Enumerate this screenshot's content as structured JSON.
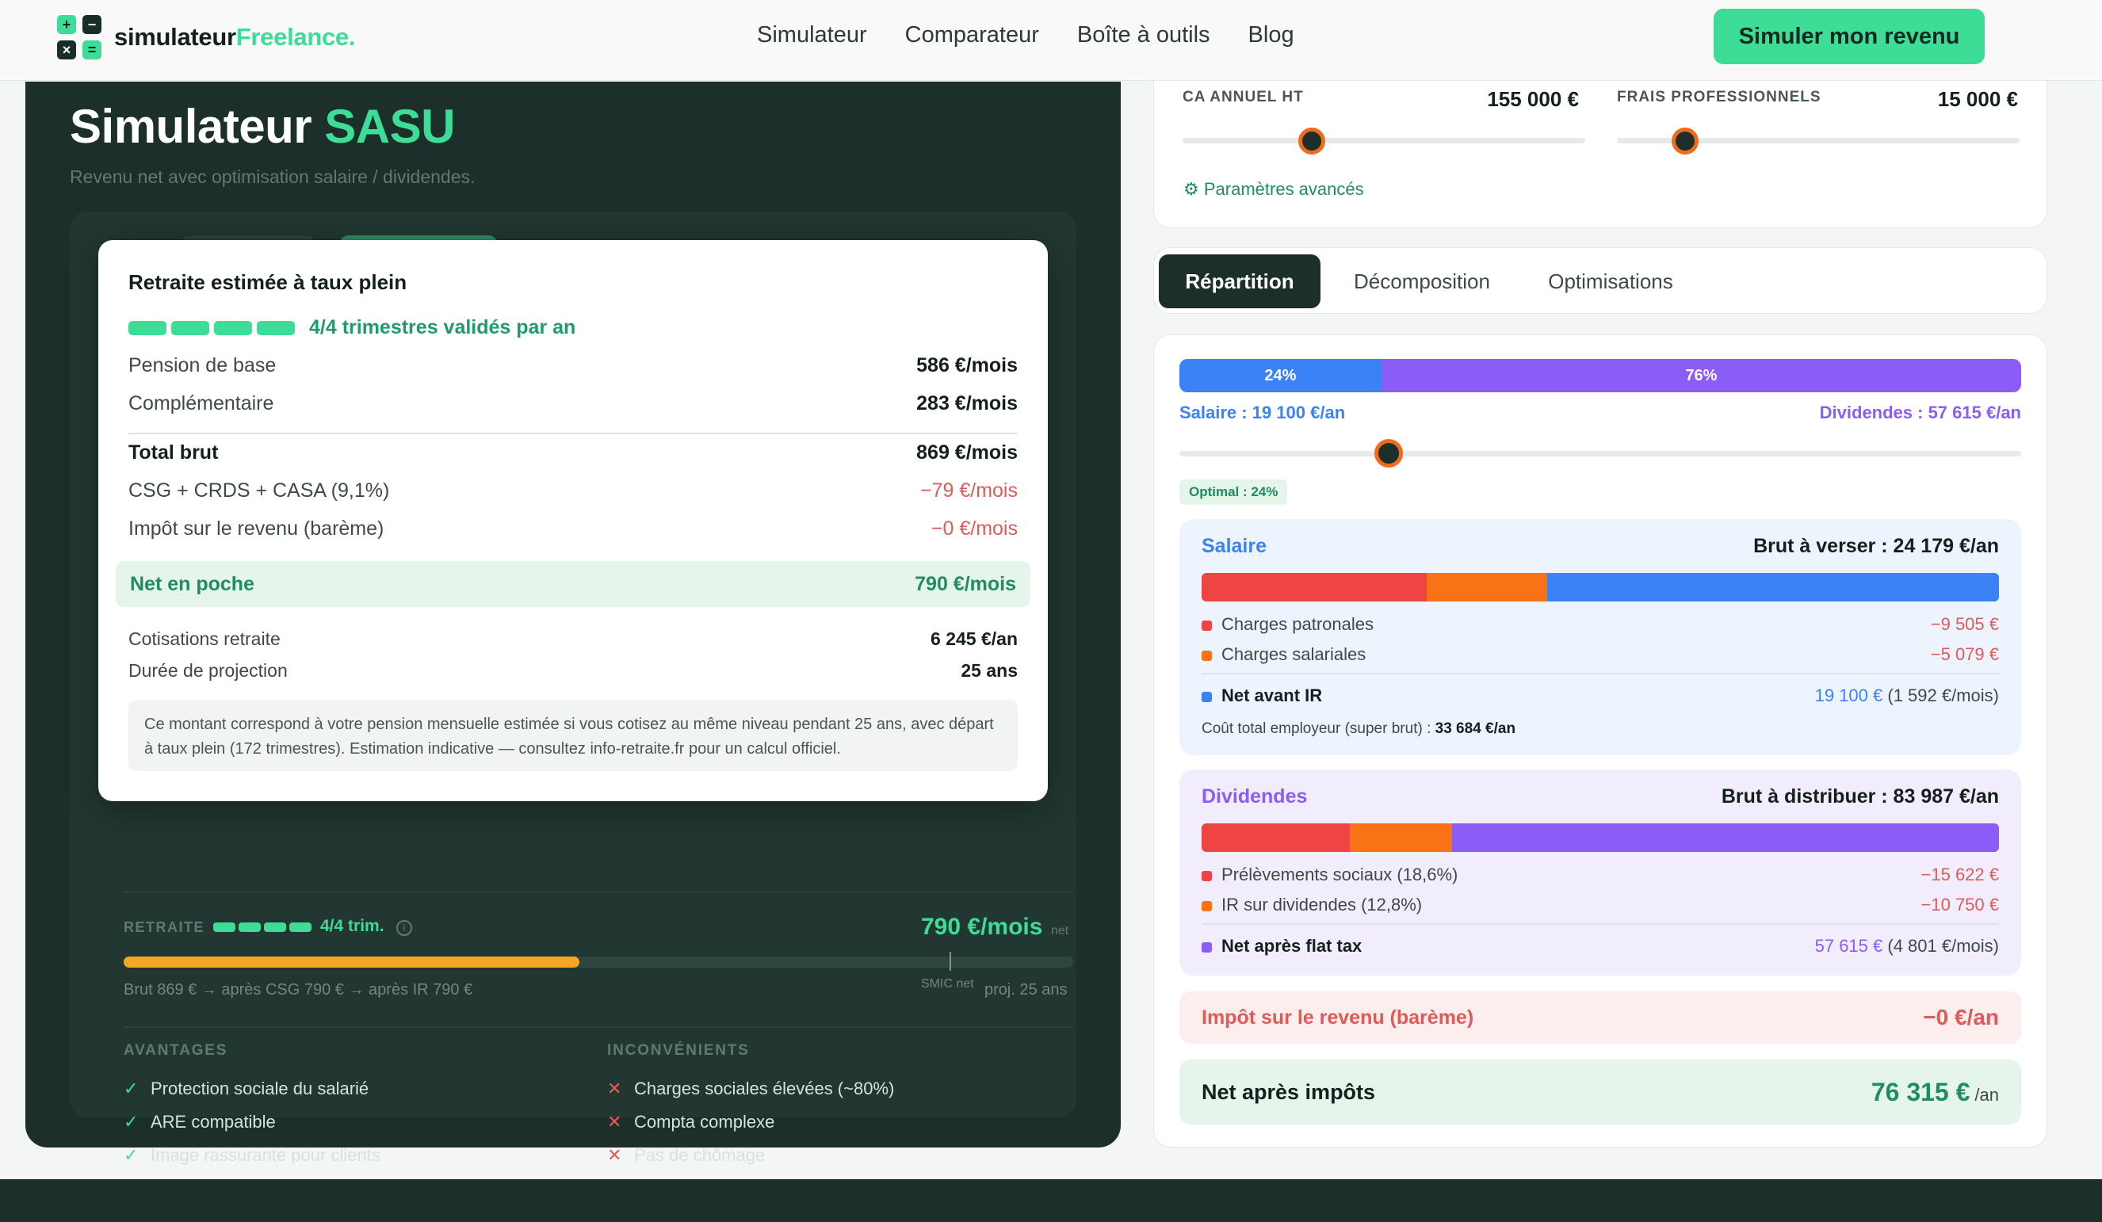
{
  "brand": {
    "name_main": "simulateur",
    "name_accent": "Freelance",
    "name_dot": ".",
    "accent_color": "#3ddc97",
    "dark_color": "#1c2f2a"
  },
  "nav": {
    "items": [
      "Simulateur",
      "Comparateur",
      "Boîte à outils",
      "Blog"
    ],
    "cta": "Simuler mon revenu"
  },
  "left": {
    "title_main": "Simulateur ",
    "title_accent": "SASU",
    "subtitle": "Revenu net avec optimisation salaire / dividendes.",
    "popup": {
      "title": "Retraite estimée à taux plein",
      "trimestres_valides": 4,
      "trimestres_total": 4,
      "trim_label": "4/4 trimestres validés par an",
      "rows": [
        {
          "label": "Pension de base",
          "value": "586 €/mois"
        },
        {
          "label": "Complémentaire",
          "value": "283 €/mois"
        },
        {
          "label": "Total brut",
          "value": "869 €/mois"
        },
        {
          "label": "CSG + CRDS + CASA (9,1%)",
          "value": "−79 €/mois"
        },
        {
          "label": "Impôt sur le revenu (barème)",
          "value": "−0 €/mois"
        }
      ],
      "net": {
        "label": "Net en poche",
        "value": "790 €/mois"
      },
      "cotisations": {
        "label": "Cotisations retraite",
        "value": "6 245 €/an"
      },
      "duree": {
        "label": "Durée de projection",
        "value": "25 ans"
      },
      "note": "Ce montant correspond à votre pension mensuelle estimée si vous cotisez au même niveau pendant 25 ans, avec départ à taux plein (172 trimestres). Estimation indicative — consultez info-retraite.fr pour un calcul officiel."
    },
    "retraite": {
      "label": "RETRAITE",
      "trim": "4/4 trim.",
      "amount": "790 €/mois",
      "net": "net",
      "progress_fraction": 0.48,
      "smic_fraction": 0.87,
      "smic_label": "SMIC net",
      "detail": "Brut 869 € → après CSG 790 € → après IR 790 €",
      "proj": "proj. 25 ans"
    },
    "avantages": {
      "title": "AVANTAGES",
      "items": [
        "Protection sociale du salarié",
        "ARE compatible",
        "Image rassurante pour clients"
      ]
    },
    "inconvenients": {
      "title": "INCONVÉNIENTS",
      "items": [
        "Charges sociales élevées (~80%)",
        "Compta complexe",
        "Pas de chômage"
      ]
    }
  },
  "right": {
    "sliders": [
      {
        "label": "CA ANNUEL HT",
        "value": "155 000 €",
        "fraction": 0.32
      },
      {
        "label": "FRAIS PROFESSIONNELS",
        "value": "15 000 €",
        "fraction": 0.17
      }
    ],
    "advanced": "Paramètres avancés",
    "tabs": [
      "Répartition",
      "Décomposition",
      "Optimisations"
    ],
    "active_tab": 0,
    "split": {
      "salaire_pct": 24,
      "dividendes_pct": 76,
      "salaire_pct_label": "24%",
      "dividendes_pct_label": "76%",
      "salaire_label": "Salaire : 19 100 €/an",
      "dividendes_label": "Dividendes : 57 615 €/an",
      "optimal": "Optimal : 24%"
    },
    "salaire": {
      "title": "Salaire",
      "brut": "Brut à verser : 24 179 €/an",
      "bar_values": [
        9505,
        5079,
        19100
      ],
      "bar_colors": [
        "#ef4444",
        "#f97316",
        "#3b82f6"
      ],
      "rows": [
        {
          "label": "Charges patronales",
          "value": "−9 505 €"
        },
        {
          "label": "Charges salariales",
          "value": "−5 079 €"
        }
      ],
      "net_label": "Net avant IR",
      "net_value": "19 100 €",
      "net_monthly": "(1 592 €/mois)",
      "cout_label": "Coût total employeur (super brut) : ",
      "cout_value": "33 684 €/an"
    },
    "dividendes": {
      "title": "Dividendes",
      "brut": "Brut à distribuer : 83 987 €/an",
      "bar_values": [
        15622,
        10750,
        57615
      ],
      "bar_colors": [
        "#ef4444",
        "#f97316",
        "#8b5cf6"
      ],
      "rows": [
        {
          "label": "Prélèvements sociaux (18,6%)",
          "value": "−15 622 €"
        },
        {
          "label": "IR sur dividendes (12,8%)",
          "value": "−10 750 €"
        }
      ],
      "net_label": "Net après flat tax",
      "net_value": "57 615 €",
      "net_monthly": "(4 801 €/mois)"
    },
    "impot": {
      "label": "Impôt sur le revenu (barème)",
      "value": "−0 €/an"
    },
    "final": {
      "label": "Net après impôts",
      "value": "76 315 €",
      "unit": "/an"
    }
  }
}
